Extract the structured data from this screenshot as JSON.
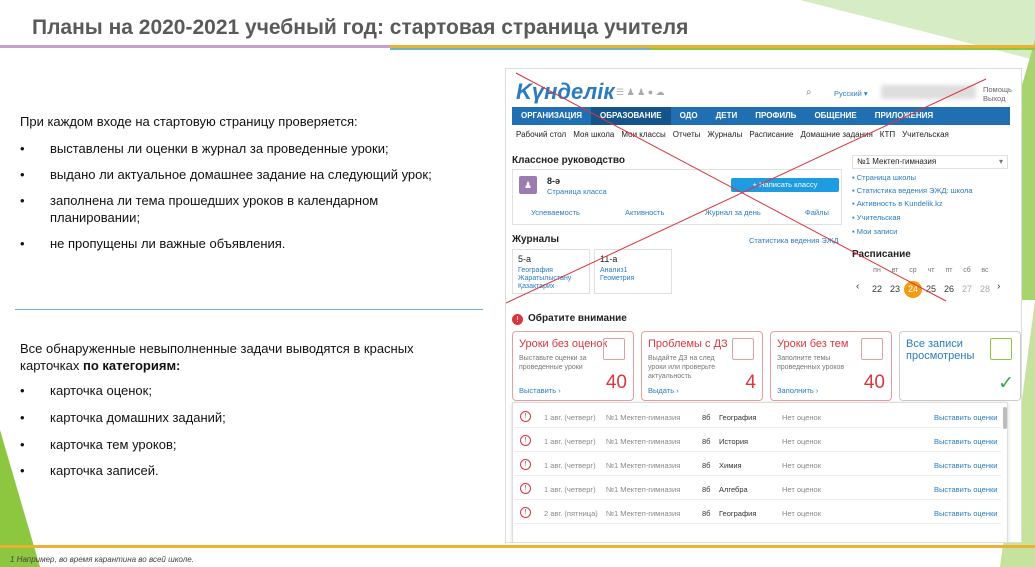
{
  "slide": {
    "title": "Планы на 2020-2021  учебный год: стартовая страница учителя",
    "intro": "При каждом входе на стартовую страницу проверяется:",
    "checks": [
      "выставлены ли оценки в журнал  за проведенные уроки;",
      "выдано ли актуальное домашнее задание на следующий урок;",
      "заполнена ли тема прошедших уроков в календарном планировании;",
      "не пропущены ли важные объявления."
    ],
    "summary_pre": "Все обнаруженные невыполненные задачи выводятся в красных карточках ",
    "summary_bold": "по категориям:",
    "categories": [
      "карточка оценок;",
      "карточка домашних заданий;",
      "карточка тем уроков;",
      "карточка записей."
    ],
    "footnote": "1      Например, во время карантина во всей школе.",
    "bullet": "•"
  },
  "app": {
    "logo": "Kүнделік",
    "lang": "Русский ▾",
    "help": "Помощь",
    "exit": "Выход",
    "nav": [
      "ОРГАНИЗАЦИЯ",
      "ОБРАЗОВАНИЕ",
      "ОДО",
      "ДЕТИ",
      "ПРОФИЛЬ",
      "ОБЩЕНИЕ",
      "ПРИЛОЖЕНИЯ"
    ],
    "subnav": [
      "Рабочий стол",
      "Моя школа",
      "Мои классы",
      "Отчеты",
      "Журналы",
      "Расписание",
      "Домашние задания",
      "КТП",
      "Учительская"
    ],
    "class_title": "Классное руководство",
    "class_name": "8-ә",
    "class_page": "Страница класса",
    "write_class": "+ Написать классу",
    "class_links": [
      "Успеваемость",
      "Активность",
      "Журнал за день",
      "Файлы"
    ],
    "journals_title": "Журналы",
    "journals_stat": "Статистика ведения ЭЖД",
    "journals": [
      {
        "name": "5-а",
        "subs": "География\nЖаратылыстану\nҚазақтарих"
      },
      {
        "name": "11-а",
        "subs": "Анализ1\nГеометрия"
      }
    ],
    "school_select": "№1 Мектеп-гимназия",
    "school_links": [
      "Страница школы",
      "Статистика ведения ЭЖД: школа",
      "Активность в Kundelik.kz",
      "Учительская",
      "Мои записи"
    ],
    "schedule_title": "Расписание",
    "weekdays": [
      "пн",
      "вт",
      "ср",
      "чт",
      "пт",
      "сб",
      "вс"
    ],
    "days": [
      "22",
      "23",
      "24",
      "25",
      "26",
      "27",
      "28"
    ],
    "attention": "Обратите внимание",
    "cards": [
      {
        "title": "Уроки без оценок",
        "desc": "Выставьте оценки за проведенные уроки",
        "link": "Выставить ›",
        "count": "40"
      },
      {
        "title": "Проблемы с ДЗ",
        "desc": "Выдайте ДЗ на след уроки или проверьте актуальность",
        "link": "Выдать ›",
        "count": "4"
      },
      {
        "title": "Уроки без тем",
        "desc": "Заполните темы проведенных уроков",
        "link": "Заполнить ›",
        "count": "40"
      },
      {
        "title": "Все записи просмотрены",
        "desc": "",
        "link": "",
        "count": "✓"
      }
    ],
    "rows": [
      {
        "date": "1 авг. (четверг)",
        "school": "№1 Мектеп-гимназия",
        "cls": "8б",
        "subj": "География",
        "status": "Нет оценок",
        "action": "Выставить оценки"
      },
      {
        "date": "1 авг. (четверг)",
        "school": "№1 Мектеп-гимназия",
        "cls": "8б",
        "subj": "История",
        "status": "Нет оценок",
        "action": "Выставить оценки"
      },
      {
        "date": "1 авг. (четверг)",
        "school": "№1 Мектеп-гимназия",
        "cls": "8б",
        "subj": "Химия",
        "status": "Нет оценок",
        "action": "Выставить оценки"
      },
      {
        "date": "1 авг. (четверг)",
        "school": "№1 Мектеп-гимназия",
        "cls": "8б",
        "subj": "Алгебра",
        "status": "Нет оценок",
        "action": "Выставить оценки"
      },
      {
        "date": "2 авг. (пятница)",
        "school": "№1 Мектеп-гимназия",
        "cls": "8б",
        "subj": "География",
        "status": "Нет оценок",
        "action": "Выставить оценки"
      }
    ]
  },
  "colors": {
    "accent": "#1f6fb2",
    "alert": "#d9363e",
    "green": "#8dc63f"
  }
}
